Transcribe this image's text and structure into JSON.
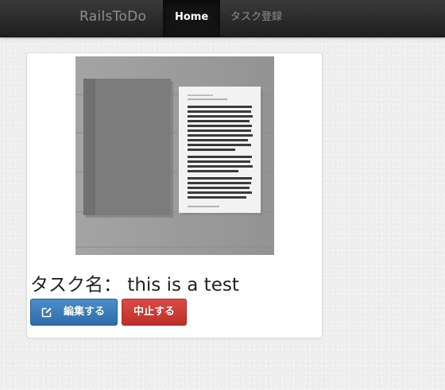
{
  "navbar": {
    "brand": "RailsToDo",
    "items": [
      {
        "label": "Home",
        "active": true
      },
      {
        "label": "タスク登録",
        "active": false
      }
    ]
  },
  "task": {
    "title": "タスク名： this is a test",
    "image_icon": "book-and-document-photo",
    "actions": {
      "edit_label": "編集する",
      "edit_icon": "edit-icon",
      "cancel_label": "中止する"
    }
  },
  "colors": {
    "navbar": "#222222",
    "edit_button": "#3572b0",
    "cancel_button": "#cf3b36"
  }
}
